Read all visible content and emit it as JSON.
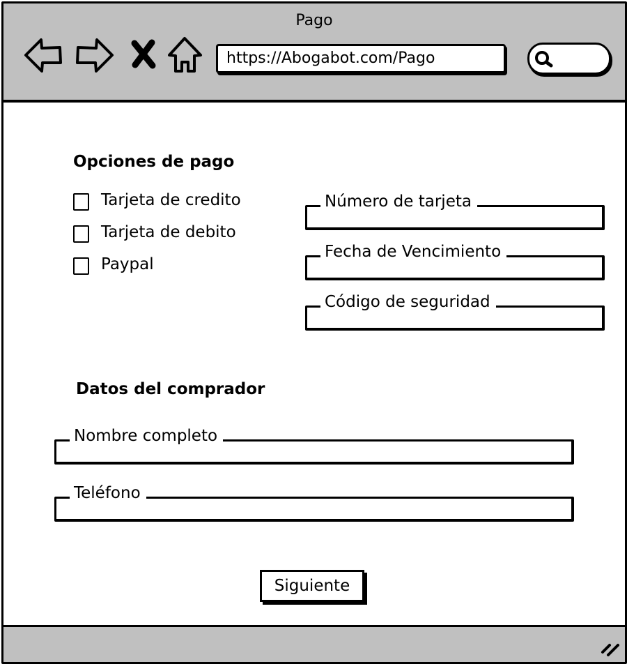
{
  "window": {
    "title": "Pago"
  },
  "toolbar": {
    "icons": [
      "back-arrow-icon",
      "forward-arrow-icon",
      "close-x-icon",
      "home-icon"
    ],
    "url": "https://Abogabot.com/Pago",
    "search_icon": "search-icon"
  },
  "payment": {
    "heading": "Opciones de pago",
    "options": [
      {
        "label": "Tarjeta de credito",
        "checked": false
      },
      {
        "label": "Tarjeta de debito",
        "checked": false
      },
      {
        "label": "Paypal",
        "checked": false
      }
    ],
    "fields": [
      {
        "label": "Número de tarjeta",
        "value": ""
      },
      {
        "label": "Fecha de Vencimiento",
        "value": ""
      },
      {
        "label": "Código de seguridad",
        "value": ""
      }
    ]
  },
  "buyer": {
    "heading": "Datos del comprador",
    "fields": [
      {
        "label": "Nombre completo",
        "value": ""
      },
      {
        "label": "Teléfono",
        "value": ""
      }
    ]
  },
  "actions": {
    "next_label": "Siguiente"
  },
  "statusbar": {
    "icon": "resize-handle-icon"
  }
}
